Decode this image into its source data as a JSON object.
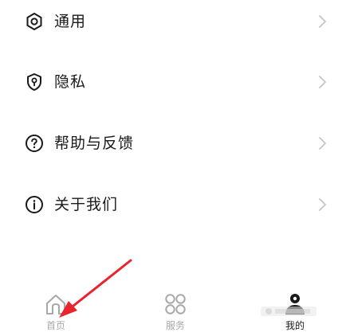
{
  "settings": {
    "items": [
      {
        "label": "通用",
        "icon": "gear-hexagon-icon"
      },
      {
        "label": "隐私",
        "icon": "shield-lock-icon"
      },
      {
        "label": "帮助与反馈",
        "icon": "help-circle-icon"
      },
      {
        "label": "关于我们",
        "icon": "info-circle-icon"
      }
    ]
  },
  "bottom_nav": {
    "tabs": [
      {
        "label": "首页",
        "icon": "home-icon",
        "state": "inactive"
      },
      {
        "label": "服务",
        "icon": "grid-four-icon",
        "state": "inactive"
      },
      {
        "label": "我的",
        "icon": "profile-icon",
        "state": "active"
      }
    ]
  },
  "colors": {
    "text_primary": "#1a1a1a",
    "text_inactive": "#a8a8a8",
    "chevron": "#c4c4c4",
    "annotation_arrow": "#e8242f",
    "background": "#ffffff"
  }
}
